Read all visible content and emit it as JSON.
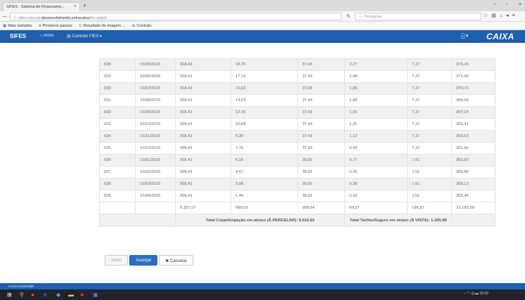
{
  "browser": {
    "tab_title": "SIFES - Sistema de Financiame...",
    "url_prefix": "sifes-internet.",
    "url_domain": "desenvolvimento.extracaixa",
    "url_suffix": "/fes-web/#",
    "search_placeholder": "Pesquisar",
    "bookmarks": [
      "Mais visitados",
      "Primeiros passos",
      "Resultado de imagem ...",
      "Contrato"
    ]
  },
  "app": {
    "brand": "SIFES",
    "nav_home": "Início",
    "nav_contrato": "Contrato FIES",
    "logo": "CAIXA"
  },
  "table": {
    "rows": [
      [
        "028",
        "15/05/2019",
        "308,41",
        "18,76",
        "37,43",
        "2,27",
        "7,37",
        "374,24"
      ],
      [
        "029",
        "15/06/2019",
        "308,41",
        "17,16",
        "37,43",
        "2,08",
        "7,37",
        "372,45"
      ],
      [
        "030",
        "15/07/2019",
        "308,41",
        "15,62",
        "37,43",
        "1,89",
        "7,37",
        "370,72"
      ],
      [
        "031",
        "15/08/2019",
        "308,41",
        "14,03",
        "37,43",
        "1,69",
        "7,37",
        "368,93"
      ],
      [
        "032",
        "15/09/2019",
        "308,41",
        "12,43",
        "37,43",
        "1,50",
        "7,37",
        "367,14"
      ],
      [
        "033",
        "15/10/2019",
        "308,41",
        "10,89",
        "37,43",
        "1,31",
        "7,37",
        "365,41"
      ],
      [
        "034",
        "15/11/2019",
        "308,41",
        "9,30",
        "37,43",
        "1,12",
        "7,37",
        "363,63"
      ],
      [
        "035",
        "15/12/2019",
        "308,41",
        "7,76",
        "37,43",
        "0,93",
        "7,37",
        "361,90"
      ],
      [
        "036",
        "15/01/2020",
        "308,41",
        "6,16",
        "38,65",
        "0,77",
        "7,61",
        "361,60"
      ],
      [
        "037",
        "15/02/2020",
        "308,41",
        "4,57",
        "38,65",
        "0,56",
        "7,61",
        "359,80"
      ],
      [
        "038",
        "15/03/2020",
        "308,41",
        "3,08",
        "38,65",
        "0,38",
        "7,61",
        "358,13"
      ],
      [
        "039",
        "15/04/2020",
        "308,41",
        "1,49",
        "38,65",
        "0,18",
        "7,61",
        "356,34"
      ]
    ],
    "totals": [
      "",
      "",
      "8.327,07",
      "589,53",
      "999,54",
      "69,57",
      "196,87",
      "10.182,58"
    ],
    "summary_coparticipacao": "Total Coparticipação em atraso (À PARCELAR): 8.916,60",
    "summary_tarifas": "Total Tarifas/Seguro em atraso (À VISTA): 1.265,98"
  },
  "buttons": {
    "voltar": "Voltar",
    "avancar": "Avançar",
    "cancelar": "Cancelar"
  },
  "footer": {
    "text": "CAIXA/CEDESBR"
  },
  "taskbar": {
    "time": "18:20"
  }
}
